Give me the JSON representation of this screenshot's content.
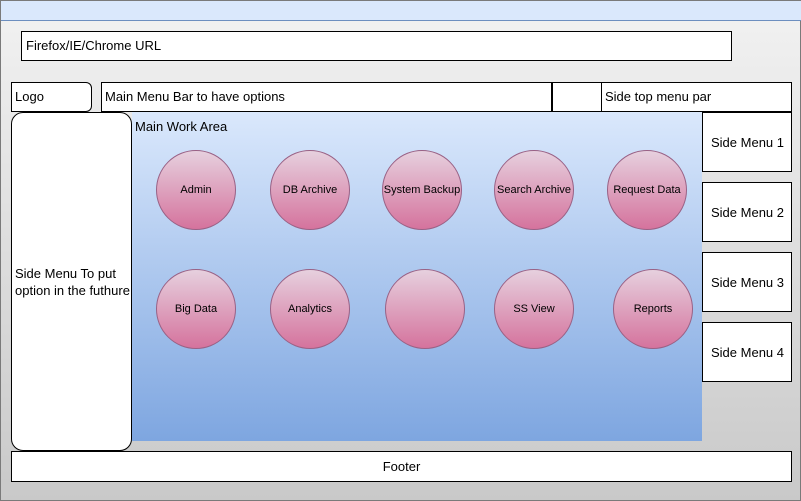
{
  "browser": {
    "url_text": "Firefox/IE/Chrome URL"
  },
  "header": {
    "logo": "Logo",
    "main_menu": "Main Menu Bar to have options",
    "side_top_menu": "Side top menu par"
  },
  "left_menu": {
    "text": "Side Menu To put option in the futhure"
  },
  "work_area": {
    "title": "Main Work Area",
    "buttons": [
      "Admin",
      "DB Archive",
      "System Backup",
      "Search Archive",
      "Request Data",
      "Big Data",
      "Analytics",
      "",
      "SS View",
      "Reports"
    ]
  },
  "side_menu": {
    "items": [
      "Side Menu 1",
      "Side Menu 2",
      "Side Menu 3",
      "Side Menu 4"
    ]
  },
  "footer": {
    "text": "Footer"
  },
  "colors": {
    "work_area_top": "#dae8fc",
    "work_area_bottom": "#7ea6e0",
    "circle_fill": "#d5739d",
    "circle_stroke": "#996185"
  }
}
